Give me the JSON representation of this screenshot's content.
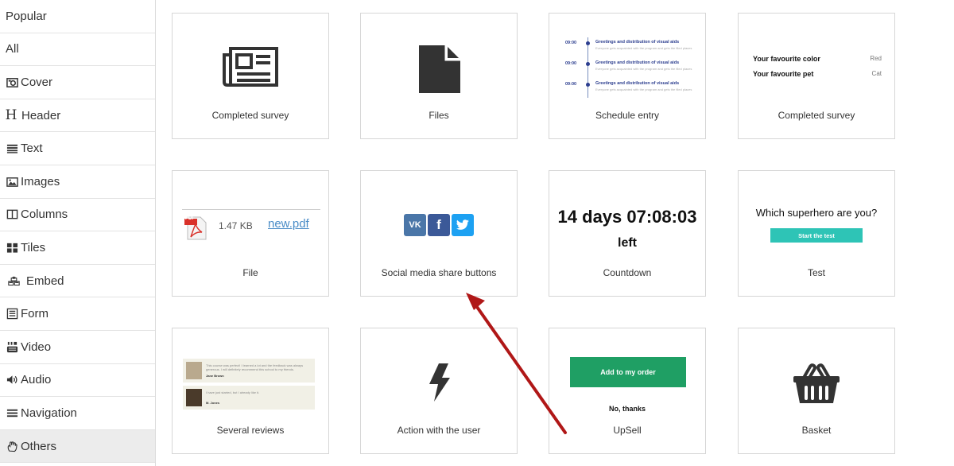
{
  "sidebar": {
    "items": [
      {
        "label": "Popular",
        "icon": "none"
      },
      {
        "label": "All",
        "icon": "none"
      },
      {
        "label": "Cover",
        "icon": "camera-icon"
      },
      {
        "label": "Header",
        "icon": "header-icon"
      },
      {
        "label": "Text",
        "icon": "text-lines-icon"
      },
      {
        "label": "Images",
        "icon": "image-icon"
      },
      {
        "label": "Columns",
        "icon": "columns-icon"
      },
      {
        "label": "Tiles",
        "icon": "tiles-icon"
      },
      {
        "label": "Embed",
        "icon": "cubes-icon"
      },
      {
        "label": "Form",
        "icon": "form-icon"
      },
      {
        "label": "Video",
        "icon": "youtube-icon"
      },
      {
        "label": "Audio",
        "icon": "speaker-icon"
      },
      {
        "label": "Navigation",
        "icon": "menu-icon"
      },
      {
        "label": "Others",
        "icon": "hand-icon"
      }
    ],
    "active": "Others",
    "header_glyph": "H"
  },
  "cards": {
    "completed_survey_1": {
      "caption": "Completed survey"
    },
    "files": {
      "caption": "Files"
    },
    "schedule": {
      "caption": "Schedule entry",
      "rows": [
        {
          "time": "09:00",
          "title": "Greetings and distribution of visual aids",
          "sub": "Everyone gets acquainted with the program and gets the filed places"
        },
        {
          "time": "09:00",
          "title": "Greetings and distribution of visual aids",
          "sub": "Everyone gets acquainted with the program and gets the filed places"
        },
        {
          "time": "09:00",
          "title": "Greetings and distribution of visual aids",
          "sub": "Everyone gets acquainted with the program and gets the filed places"
        }
      ]
    },
    "completed_survey_2": {
      "caption": "Completed survey",
      "rows": [
        {
          "key": "Your favourite color",
          "value": "Red"
        },
        {
          "key": "Your favourite pet",
          "value": "Cat"
        }
      ]
    },
    "file": {
      "caption": "File",
      "size": "1.47 KB",
      "link": "new.pdf",
      "pdf_label": "PDF"
    },
    "social": {
      "caption": "Social media share buttons",
      "vk_label": "VK",
      "fb_label": "f",
      "colors": {
        "vk": "#4a76a8",
        "fb": "#3b5998",
        "tw": "#1da1f2"
      }
    },
    "countdown": {
      "caption": "Countdown",
      "time": "14 days 07:08:03",
      "left": "left"
    },
    "test": {
      "caption": "Test",
      "question": "Which superhero are you?",
      "button": "Start the test",
      "accent": "#2ec4b6"
    },
    "reviews": {
      "caption": "Several reviews",
      "items": [
        {
          "text": "This course was perfect! I learned a lot and the feedback was always generous. I will definitely recommend this school to my friends.",
          "name": "Jane Brown"
        },
        {
          "text": "I have just started, but I already like it.",
          "name": "M. Jones"
        }
      ]
    },
    "action": {
      "caption": "Action with the user"
    },
    "upsell": {
      "caption": "UpSell",
      "button": "Add to my order",
      "no": "No, thanks",
      "accent": "#1f9f64"
    },
    "basket": {
      "caption": "Basket"
    }
  },
  "annotation": {
    "arrow_color": "#b01717"
  }
}
